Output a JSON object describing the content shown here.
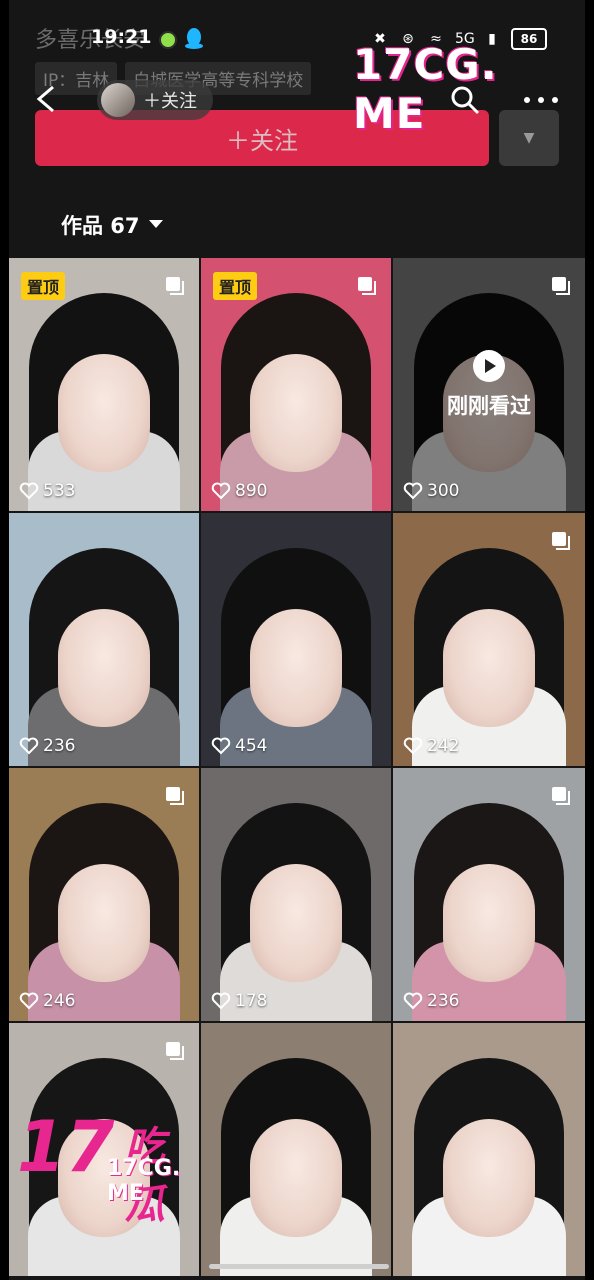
{
  "profile_ghost": {
    "name": "多喜乐长安",
    "tags": [
      "IP：吉林",
      "白城医学高等专科学校"
    ],
    "follow_label": "＋关注"
  },
  "status": {
    "time": "19:21",
    "battery": "86",
    "net_label": "5G"
  },
  "header": {
    "follow_pill_label": "＋关注"
  },
  "tabs": {
    "works_label": "作品 67"
  },
  "grid": [
    {
      "badge": "置顶",
      "likes": "533",
      "multi": true,
      "hair": "#121212",
      "bg": "#bfb9b4",
      "face_tone": "light",
      "watched": false,
      "body_color": "#d9d9d9"
    },
    {
      "badge": "置顶",
      "likes": "890",
      "multi": true,
      "hair": "#1a1412",
      "bg": "#d4516f",
      "face_tone": "light",
      "watched": false,
      "body_color": "#c99aa7"
    },
    {
      "badge": "",
      "likes": "300",
      "multi": true,
      "hair": "#0e0e0e",
      "bg": "#7c7c7c",
      "face_tone": "light",
      "watched": true,
      "watched_label": "刚刚看过",
      "body_color": "#e8e8e8"
    },
    {
      "badge": "",
      "likes": "236",
      "multi": false,
      "hair": "#151515",
      "bg": "#a9bcc9",
      "face_tone": "light",
      "watched": false,
      "body_color": "#6d6d70"
    },
    {
      "badge": "",
      "likes": "454",
      "multi": false,
      "hair": "#101010",
      "bg": "#2f3038",
      "face_tone": "light",
      "watched": false,
      "body_color": "#6b7480"
    },
    {
      "badge": "",
      "likes": "242",
      "multi": true,
      "hair": "#141414",
      "bg": "#8c6a49",
      "face_tone": "light",
      "watched": false,
      "body_color": "#f0f0ee"
    },
    {
      "badge": "",
      "likes": "246",
      "multi": true,
      "hair": "#1b1613",
      "bg": "#9a7c55",
      "face_tone": "light",
      "watched": false,
      "body_color": "#c791a8"
    },
    {
      "badge": "",
      "likes": "178",
      "multi": false,
      "hair": "#131313",
      "bg": "#6f6a6a",
      "face_tone": "light",
      "watched": false,
      "body_color": "#dfdbd9"
    },
    {
      "badge": "",
      "likes": "236",
      "multi": true,
      "hair": "#1a1716",
      "bg": "#9fa2a4",
      "face_tone": "light",
      "watched": false,
      "body_color": "#d394aa"
    },
    {
      "badge": "",
      "likes": "",
      "multi": true,
      "hair": "#161616",
      "bg": "#b9b3ad",
      "face_tone": "light",
      "watched": false,
      "body_color": "#e6e6e6"
    },
    {
      "badge": "",
      "likes": "",
      "multi": false,
      "hair": "#111111",
      "bg": "#8d7e72",
      "face_tone": "light",
      "watched": false,
      "body_color": "#efefed"
    },
    {
      "badge": "",
      "likes": "",
      "multi": false,
      "hair": "#151515",
      "bg": "#a99a8b",
      "face_tone": "light",
      "watched": false,
      "body_color": "#f2f2f2"
    }
  ],
  "watermarks": {
    "top": "17CG. ME",
    "bottom_num": "17",
    "bottom_cn": "吃瓜",
    "bottom_url": "17CG. ME"
  },
  "colors": {
    "accent": "#fe2c55",
    "badge": "#ffcc14",
    "watermark": "#e7278f"
  }
}
